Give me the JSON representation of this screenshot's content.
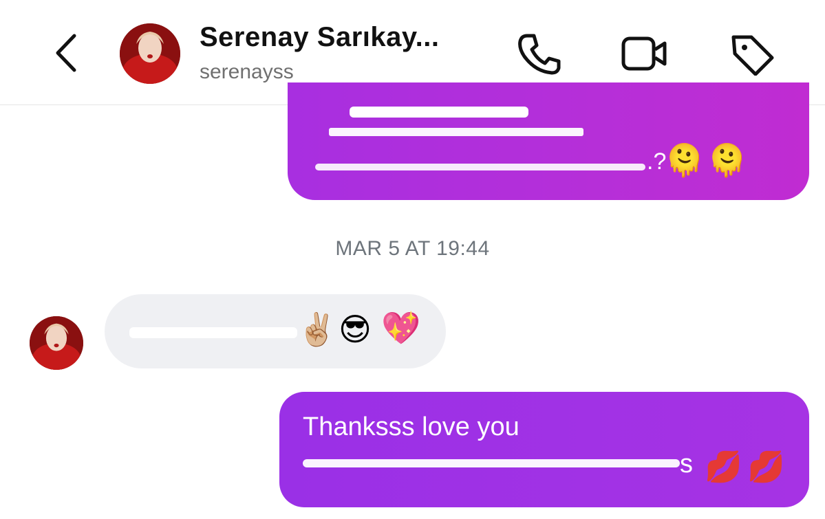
{
  "header": {
    "contact_name": "Serenay Sarıkay...",
    "contact_handle": "serenayss"
  },
  "icons": {
    "back": "chevron-left-icon",
    "call": "phone-icon",
    "video": "video-camera-icon",
    "tag": "tag-icon"
  },
  "messages": {
    "top_bubble": {
      "line2_visible_suffix": ".?",
      "emojis": [
        "🫠",
        "🫠"
      ]
    },
    "timestamp": "MAR 5 AT 19:44",
    "incoming": {
      "emojis": [
        "✌🏼",
        "😎",
        "💖"
      ]
    },
    "outgoing": {
      "line1": "Thanksss love you",
      "line2_visible_suffix": "s",
      "emojis": [
        "💋",
        "💋"
      ]
    }
  },
  "colors": {
    "outgoing_bubble": "#a82fe0",
    "incoming_bubble": "#eff0f3",
    "timestamp_text": "#6d747b"
  }
}
